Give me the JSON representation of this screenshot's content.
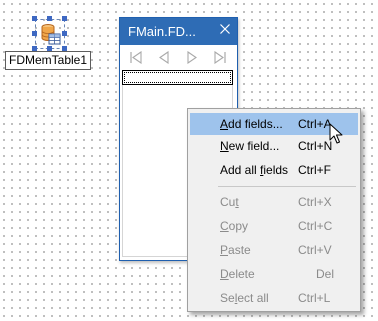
{
  "component": {
    "caption": "FDMemTable1",
    "icon": "database-table-icon"
  },
  "form": {
    "title": "FMain.FD...",
    "close_icon": "close-icon",
    "navigator": {
      "buttons": [
        "first-record-icon",
        "prior-record-icon",
        "next-record-icon",
        "last-record-icon"
      ]
    }
  },
  "context_menu": {
    "items": [
      {
        "label": "Add fields...",
        "mnemonic": "A",
        "shortcut": "Ctrl+A",
        "enabled": true,
        "highlighted": true
      },
      {
        "label": "New field...",
        "mnemonic": "N",
        "shortcut": "Ctrl+N",
        "enabled": true,
        "highlighted": false
      },
      {
        "label": "Add all fields",
        "mnemonic": "f",
        "shortcut": "Ctrl+F",
        "enabled": true,
        "highlighted": false
      },
      {
        "label": "Cut",
        "mnemonic": "t",
        "shortcut": "Ctrl+X",
        "enabled": false,
        "highlighted": false
      },
      {
        "label": "Copy",
        "mnemonic": "C",
        "shortcut": "Ctrl+C",
        "enabled": false,
        "highlighted": false
      },
      {
        "label": "Paste",
        "mnemonic": "P",
        "shortcut": "Ctrl+V",
        "enabled": false,
        "highlighted": false
      },
      {
        "label": "Delete",
        "mnemonic": "D",
        "shortcut": "Del",
        "enabled": false,
        "highlighted": false
      },
      {
        "label": "Select all",
        "mnemonic": "l",
        "shortcut": "Ctrl+L",
        "enabled": false,
        "highlighted": false
      }
    ]
  },
  "colors": {
    "title_bar": "#2e6cb5",
    "menu_highlight": "#9ec3ec",
    "menu_background": "#f0f0f0",
    "disabled_text": "#8b8b8b",
    "selection_handle": "#3e68c2"
  }
}
